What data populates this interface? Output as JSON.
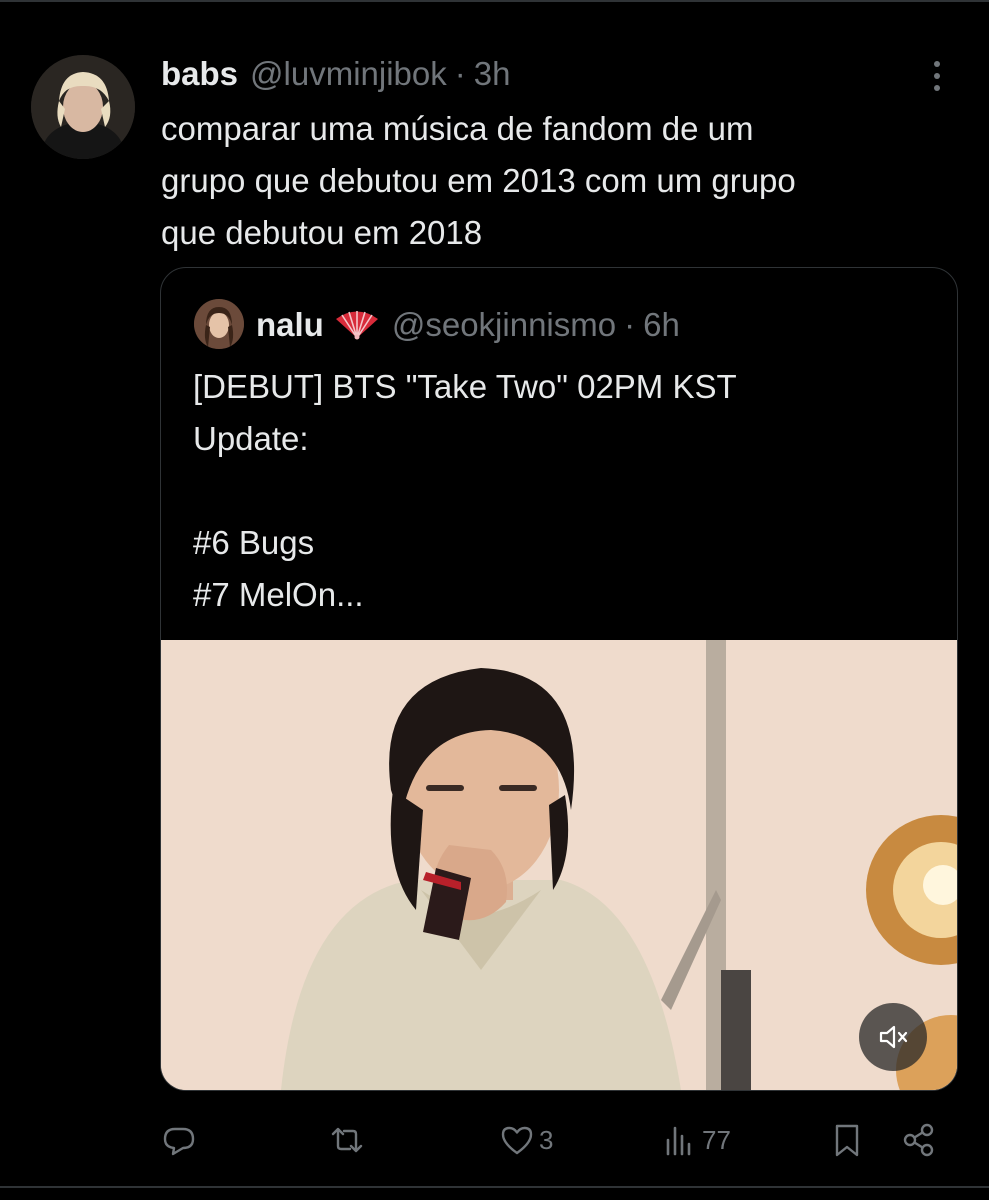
{
  "tweet": {
    "author_name": "babs",
    "author_handle": "@luvminjibok",
    "separator": "·",
    "time": "3h",
    "text": "comparar uma música de fandom de um\ngrupo que debutou em 2013 com um grupo\nque debutou em 2018"
  },
  "quoted": {
    "author_name": "nalu",
    "author_emoji_icon": "folding-fan-icon",
    "author_handle": "@seokjinnismo",
    "separator": "·",
    "time": "6h",
    "text": "[DEBUT] BTS \"Take Two\" 02PM KST\nUpdate:\n\n#6 Bugs\n#7 MelOn..."
  },
  "actions": {
    "reply_icon": "reply-icon",
    "retweet_icon": "retweet-icon",
    "like_icon": "heart-icon",
    "like_count": "3",
    "views_icon": "analytics-icon",
    "views_count": "77",
    "bookmark_icon": "bookmark-icon",
    "share_icon": "share-icon"
  },
  "colors": {
    "background": "#000000",
    "text_primary": "#e7e9ea",
    "text_secondary": "#71767b",
    "border": "#2f3336"
  }
}
